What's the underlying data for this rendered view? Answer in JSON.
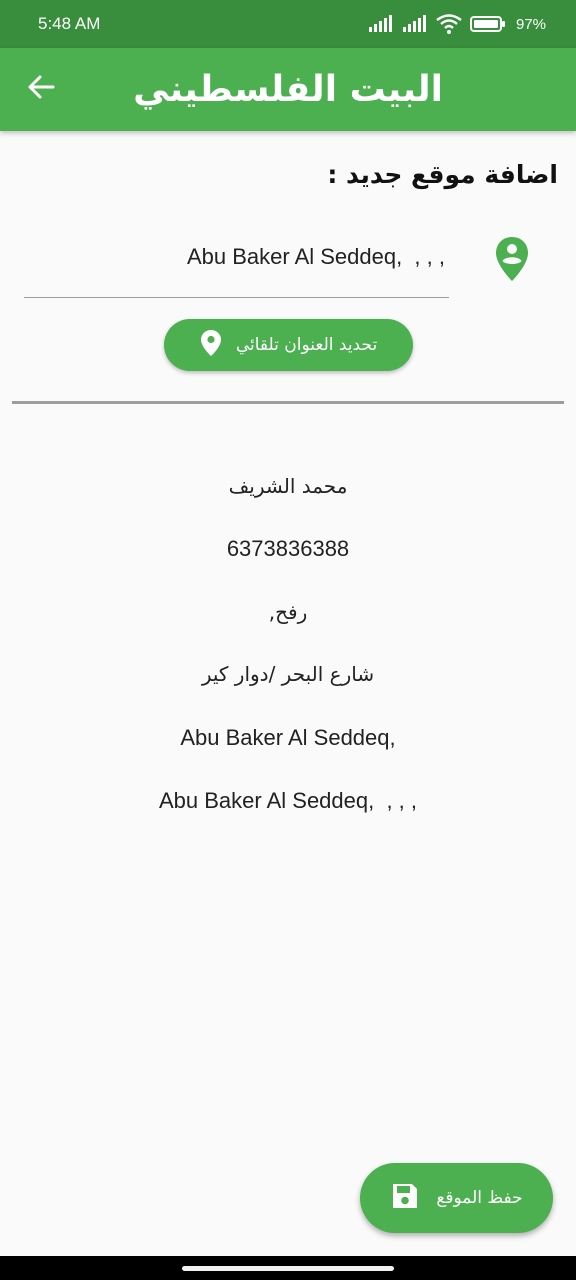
{
  "status_bar": {
    "time": "5:48 AM",
    "battery": "97%",
    "icons": [
      "signal-icon",
      "signal-icon",
      "wifi-icon",
      "battery-icon"
    ]
  },
  "app_bar": {
    "title": "البيت الفلسطيني",
    "back_icon": "arrow-left-icon"
  },
  "form": {
    "section_title": "اضافة موقع جديد :",
    "address_value": "Abu Baker Al Seddeq,  , , ,",
    "location_icon": "person-pin-icon",
    "auto_button_label": "تحديد العنوان تلقائي",
    "auto_button_icon": "map-pin-icon"
  },
  "details": {
    "name": "محمد الشريف",
    "phone": "6373836388",
    "city": "رفح,",
    "street": "شارع البحر /دوار كير",
    "area": "Abu Baker Al Seddeq,",
    "full_address": "Abu Baker Al Seddeq,  , , ,"
  },
  "save_button": {
    "label": "حفظ الموقع",
    "icon": "save-icon"
  },
  "colors": {
    "accent": "#4caf50",
    "status_bar": "#388e3c",
    "background": "#fafafa",
    "divider": "#9e9e9e"
  }
}
